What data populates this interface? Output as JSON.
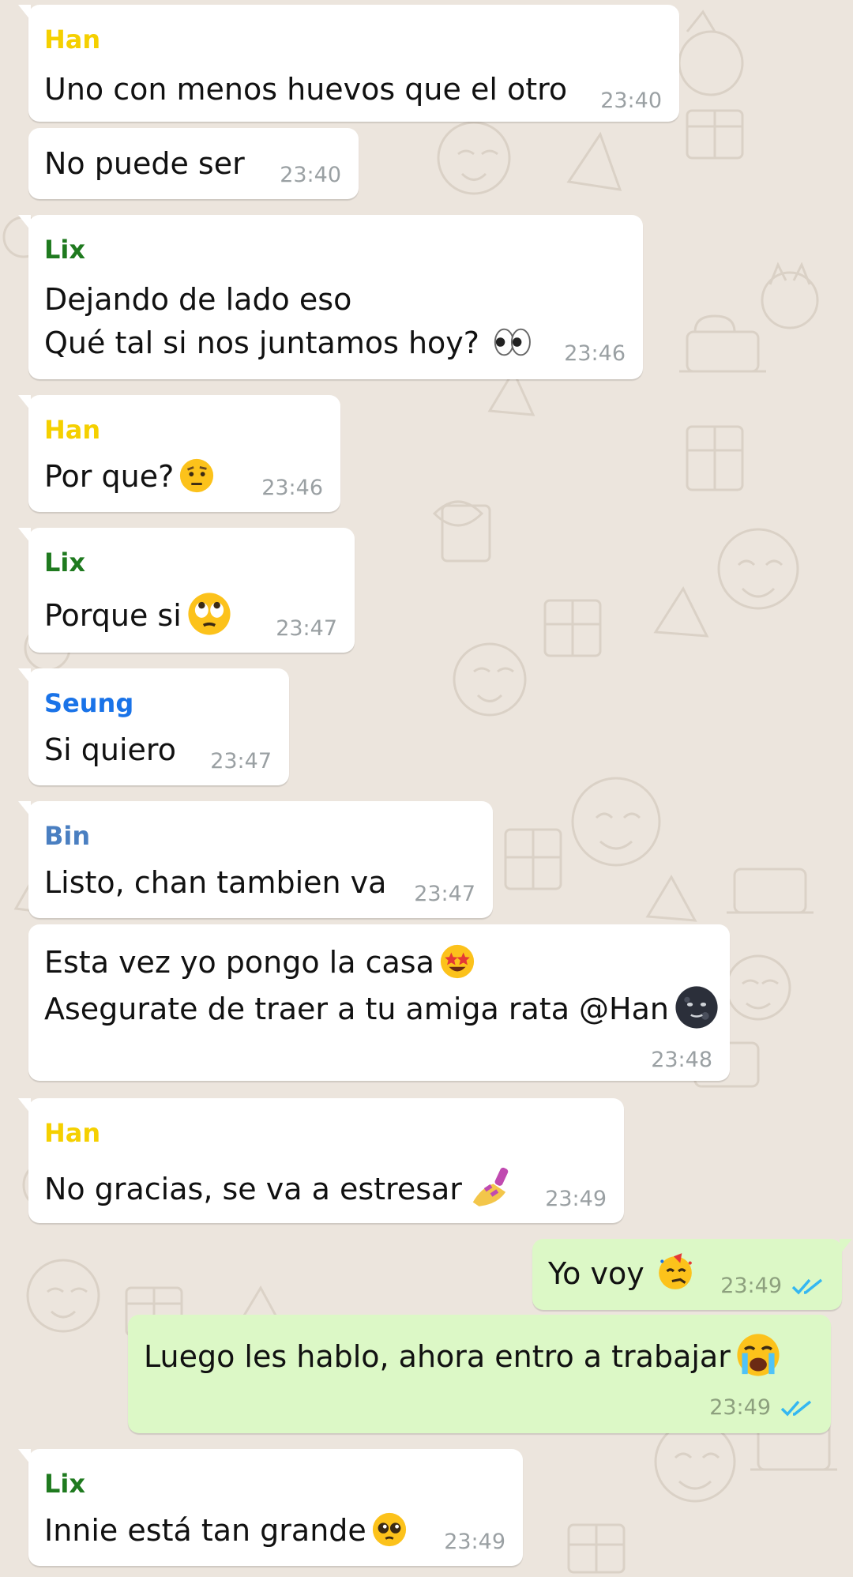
{
  "colors": {
    "wallpaper": "#ece5dd",
    "bubble_in": "#ffffff",
    "bubble_out": "#dcf8c6",
    "timestamp": "#9aa0a3",
    "read_ticks": "#34b7f1",
    "sender_han": "#f5d000",
    "sender_lix": "#1f7a1f",
    "sender_seung": "#1a73e8",
    "sender_bin": "#4a7fc1"
  },
  "messages": [
    {
      "sender": "Han",
      "text": "Uno con menos huevos que el otro",
      "time": "23:40"
    },
    {
      "text": "No puede ser",
      "time": "23:40"
    },
    {
      "sender": "Lix",
      "line1": "Dejando de lado eso",
      "line2": "Qué tal si nos juntamos hoy?",
      "emoji": "eyes-emoji",
      "time": "23:46"
    },
    {
      "sender": "Han",
      "text": "Por que?",
      "emoji": "raised-eyebrow-emoji",
      "time": "23:46"
    },
    {
      "sender": "Lix",
      "text": "Porque si",
      "emoji": "rolling-eyes-emoji",
      "time": "23:47"
    },
    {
      "sender": "Seung",
      "text": "Si quiero",
      "time": "23:47"
    },
    {
      "sender": "Bin",
      "text": "Listo, chan tambien va",
      "time": "23:47"
    },
    {
      "line1": "Esta vez yo pongo la casa",
      "line1_emoji": "star-struck-emoji",
      "line2": "Asegurate de traer a tu amiga rata @Han",
      "line2_emoji": "new-moon-face-emoji",
      "time": "23:48"
    },
    {
      "sender": "Han",
      "text": "No gracias, se va a estresar",
      "emoji": "nail-polish-emoji",
      "time": "23:49"
    },
    {
      "text": "Yo voy",
      "emoji": "partying-face-emoji",
      "time": "23:49",
      "status": "read"
    },
    {
      "text": "Luego les hablo, ahora entro a trabajar",
      "emoji": "loudly-crying-emoji",
      "time": "23:49",
      "status": "read"
    },
    {
      "sender": "Lix",
      "text": "Innie está tan grande",
      "emoji": "pleading-face-emoji",
      "time": "23:49"
    }
  ]
}
